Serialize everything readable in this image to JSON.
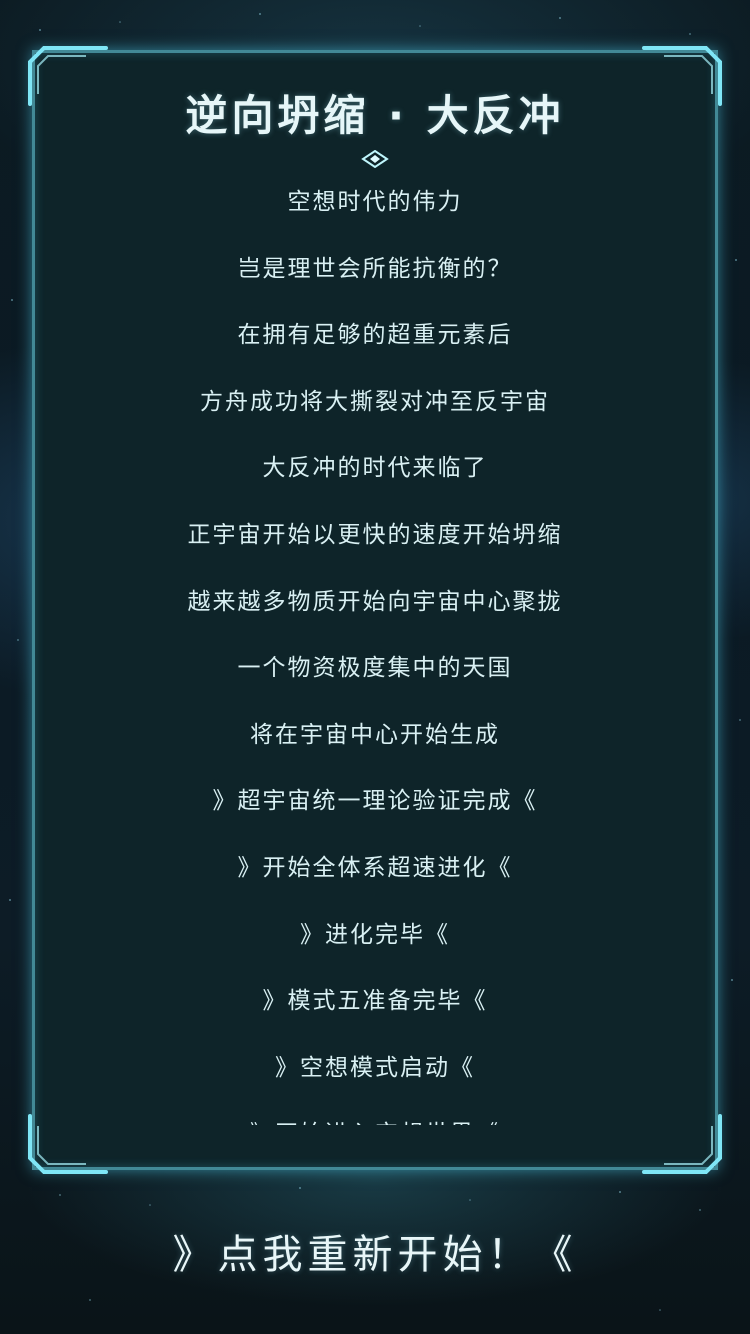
{
  "dialog": {
    "title": "逆向坍缩 · 大反冲",
    "lines": [
      "空想时代的伟力",
      "岂是理世会所能抗衡的？",
      "在拥有足够的超重元素后",
      "方舟成功将大撕裂对冲至反宇宙",
      "大反冲的时代来临了",
      "正宇宙开始以更快的速度开始坍缩",
      "越来越多物质开始向宇宙中心聚拢",
      "一个物资极度集中的天国",
      "将在宇宙中心开始生成",
      "》超宇宙统一理论验证完成《",
      "》开始全体系超速进化《",
      "》进化完毕《",
      "》模式五准备完毕《",
      "》空想模式启动《",
      "》开始进入空想世界《"
    ]
  },
  "restart_button": {
    "label": "》点我重新开始！《"
  },
  "colors": {
    "accent": "#6ee0f4",
    "panel_bg": "#0e2429",
    "text": "#d9f0f3"
  }
}
